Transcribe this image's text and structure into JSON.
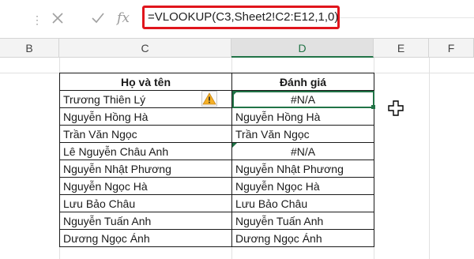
{
  "formula_bar": {
    "more_icon": "more-dots-icon",
    "cancel_icon": "cancel-x-icon",
    "enter_icon": "enter-check-icon",
    "function_label": "fx",
    "formula": "=VLOOKUP(C3,Sheet2!C2:E12,1,0)",
    "highlight_color": "#e0151c"
  },
  "columns": [
    "B",
    "C",
    "D",
    "E",
    "F"
  ],
  "selected_column": "D",
  "table": {
    "headers": [
      "Họ và tên",
      "Đánh giá"
    ],
    "rows": [
      [
        "Trương Thiên Lý",
        "#N/A"
      ],
      [
        "Nguyễn Hồng Hà",
        "Nguyễn Hồng Hà"
      ],
      [
        "Trần Văn Ngọc",
        "Trần Văn Ngọc"
      ],
      [
        "Lê Nguyễn Châu Anh",
        "#N/A"
      ],
      [
        "Nguyễn Nhật Phương",
        "Nguyễn Nhật Phương"
      ],
      [
        "Nguyễn Ngọc Hà",
        "Nguyễn Ngọc Hà"
      ],
      [
        "Lưu Bảo Châu",
        "Lưu Bảo Châu"
      ],
      [
        "Nguyễn Tuấn Anh",
        "Nguyễn Tuấn Anh"
      ],
      [
        "Dương Ngọc Ánh",
        "Dương Ngọc Ánh"
      ]
    ]
  },
  "icons": {
    "error_indicator": "warning-triangle-icon",
    "cursor": "cell-select-cross-cursor-icon"
  },
  "accent_color": "#217346"
}
